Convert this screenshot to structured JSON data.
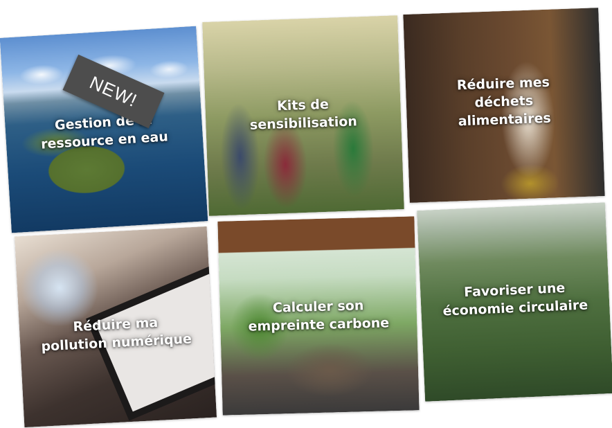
{
  "tiles": [
    {
      "id": "t1",
      "title": "Gestion de la\nressource en eau"
    },
    {
      "id": "t2",
      "title": "Kits de\nsensibilisation"
    },
    {
      "id": "t3",
      "title": "Réduire mes\ndéchets\nalimentaires"
    },
    {
      "id": "t4",
      "title": "Réduire ma\npollution numérique"
    },
    {
      "id": "t5",
      "title": "Calculer son\nempreinte carbone"
    },
    {
      "id": "t6",
      "title": "Favoriser une\néconomie circulaire"
    }
  ],
  "badge": {
    "label": "NEW!"
  },
  "colors": {
    "label_text": "#ffffff",
    "badge_bg": "#4d4d4d",
    "page_bg": "#ffffff"
  }
}
